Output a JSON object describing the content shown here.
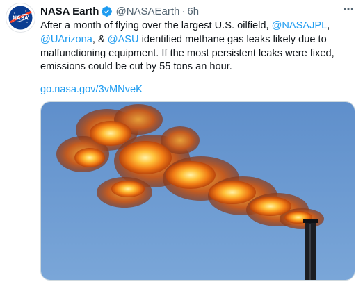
{
  "tweet": {
    "author_name": "NASA Earth",
    "handle": "@NASAEarth",
    "separator": "·",
    "time": "6h",
    "avatar_label": "NASA",
    "text_part1": "After a month of flying over the largest U.S. oilfield, ",
    "mention1": "@NASAJPL",
    "text_part2": ", ",
    "mention2": "@UArizona",
    "text_part3": ", & ",
    "mention3": "@ASU",
    "text_part4": " identified methane gas leaks likely due to malfunctioning equipment. If the most persistent leaks were fixed, emissions could be cut by 55 tons an hour.",
    "link": "go.nasa.gov/3vMNveK"
  },
  "icons": {
    "verified": "verified-badge-icon",
    "more": "more-options-icon"
  },
  "colors": {
    "accent": "#1d9bf0",
    "secondary_text": "#536471",
    "sky": "#5f8fc4",
    "flame": "#f08a1e"
  }
}
